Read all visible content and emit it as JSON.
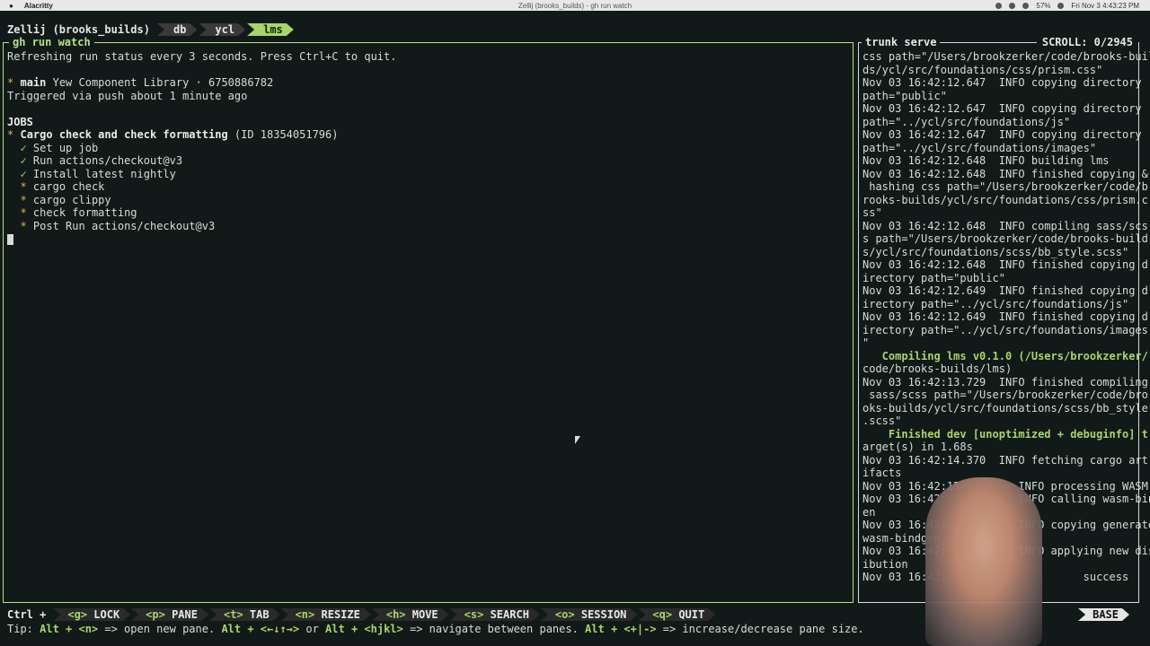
{
  "menubar": {
    "app_name": "Alacritty",
    "window_title": "Zellij (brooks_builds) - gh run watch",
    "battery": "57%",
    "datetime": "Fri Nov 3  4:43:23 PM"
  },
  "tabbar": {
    "session": "Zellij (brooks_builds)",
    "tabs": [
      {
        "label": "db",
        "active": false
      },
      {
        "label": "ycl",
        "active": false
      },
      {
        "label": "lms",
        "active": true
      }
    ]
  },
  "left_pane": {
    "title": "gh run watch",
    "line_refresh": "Refreshing run status every 3 seconds. Press Ctrl+C to quit.",
    "run_branch": "main",
    "run_repo": " Yew Component Library · 6750886782",
    "trigger": "Triggered via push about 1 minute ago",
    "jobs_header": "JOBS",
    "job_name": "Cargo check and check formatting",
    "job_id": " (ID 18354051796)",
    "steps": [
      {
        "icon": "✓",
        "label": "Set up job",
        "done": true
      },
      {
        "icon": "✓",
        "label": "Run actions/checkout@v3",
        "done": true
      },
      {
        "icon": "✓",
        "label": "Install latest nightly",
        "done": true
      },
      {
        "icon": "*",
        "label": "cargo check",
        "done": false
      },
      {
        "icon": "*",
        "label": "cargo clippy",
        "done": false
      },
      {
        "icon": "*",
        "label": "check formatting",
        "done": false
      },
      {
        "icon": "*",
        "label": "Post Run actions/checkout@v3",
        "done": false
      }
    ]
  },
  "right_pane": {
    "title": "trunk serve",
    "scroll": "SCROLL:  0/2945",
    "lines": [
      "css path=\"/Users/brookzerker/code/brooks-buil",
      "ds/ycl/src/foundations/css/prism.css\"",
      "Nov 03 16:42:12.647  INFO copying directory",
      "path=\"public\"",
      "Nov 03 16:42:12.647  INFO copying directory",
      "path=\"../ycl/src/foundations/js\"",
      "Nov 03 16:42:12.647  INFO copying directory",
      "path=\"../ycl/src/foundations/images\"",
      "Nov 03 16:42:12.648  INFO building lms",
      "Nov 03 16:42:12.648  INFO finished copying &",
      " hashing css path=\"/Users/brookzerker/code/b",
      "rooks-builds/ycl/src/foundations/css/prism.c",
      "ss\"",
      "Nov 03 16:42:12.648  INFO compiling sass/scs",
      "s path=\"/Users/brookzerker/code/brooks-build",
      "s/ycl/src/foundations/scss/bb_style.scss\"",
      "Nov 03 16:42:12.648  INFO finished copying d",
      "irectory path=\"public\"",
      "Nov 03 16:42:12.649  INFO finished copying d",
      "irectory path=\"../ycl/src/foundations/js\"",
      "Nov 03 16:42:12.649  INFO finished copying d",
      "irectory path=\"../ycl/src/foundations/images",
      "\"",
      "   Compiling lms v0.1.0 (/Users/brookzerker/",
      "code/brooks-builds/lms)",
      "Nov 03 16:42:13.729  INFO finished compiling",
      " sass/scss path=\"/Users/brookzerker/code/bro",
      "oks-builds/ycl/src/foundations/scss/bb_style",
      ".scss\"",
      "    Finished dev [unoptimized + debuginfo] t",
      "arget(s) in 1.68s",
      "Nov 03 16:42:14.370  INFO fetching cargo art",
      "ifacts",
      "Nov 03 16:42:15         INFO processing WASM",
      "Nov 03 16:42:           INFO calling wasm-bindg",
      "en",
      "Nov 03 16:42:           INFO copying generated",
      "wasm-bindgen",
      "Nov 03 16:42:           INFO applying new distr",
      "ibution",
      "Nov 03 16:42:                     success"
    ]
  },
  "statusbar": {
    "ctrl": "Ctrl +",
    "keys": [
      {
        "key": "<g>",
        "label": " LOCK"
      },
      {
        "key": "<p>",
        "label": " PANE"
      },
      {
        "key": "<t>",
        "label": " TAB"
      },
      {
        "key": "<n>",
        "label": " RESIZE"
      },
      {
        "key": "<h>",
        "label": " MOVE"
      },
      {
        "key": "<s>",
        "label": " SEARCH"
      },
      {
        "key": "<o>",
        "label": " SESSION"
      },
      {
        "key": "<q>",
        "label": " QUIT"
      }
    ],
    "mode": "BASE",
    "tip_prefix": "Tip: ",
    "tip_a": "Alt + <n>",
    "tip_b": " => open new pane. ",
    "tip_c": "Alt + <←↓↑→>",
    "tip_d": " or ",
    "tip_e": "Alt + <hjkl>",
    "tip_f": " => navigate between panes. ",
    "tip_g": "Alt + <+|->",
    "tip_h": " => increase/decrease pane size."
  },
  "colors": {
    "background": "#111a18",
    "accent_green": "#a6d66a",
    "pending_star": "#e6b14a"
  }
}
